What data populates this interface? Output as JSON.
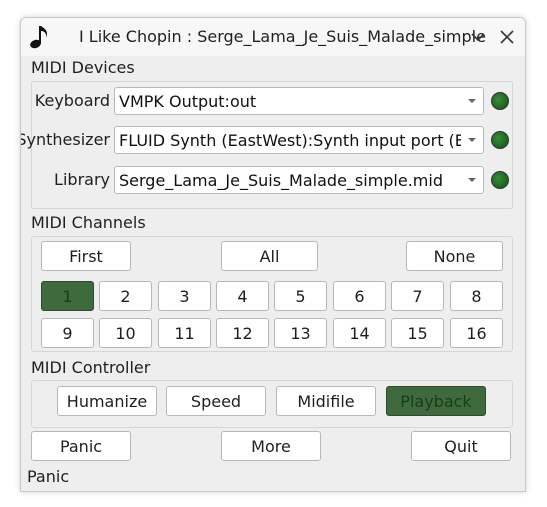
{
  "window": {
    "title": "I Like Chopin : Serge_Lama_Je_Suis_Malade_simple"
  },
  "titlebar": {
    "icons": [
      "music-note-icon",
      "chevron-down-icon",
      "close-icon"
    ]
  },
  "midi_devices": {
    "section_label": "MIDI Devices",
    "keyboard": {
      "label": "Keyboard",
      "value": "VMPK Output:out",
      "led_color": "#2a7a2a"
    },
    "synthesizer": {
      "label": "Synthesizer",
      "value": "FLUID Synth (EastWest):Synth input port (EastW",
      "led_color": "#2a7a2a"
    },
    "library": {
      "label": "Library",
      "value": "Serge_Lama_Je_Suis_Malade_simple.mid",
      "led_color": "#2a7a2a"
    }
  },
  "midi_channels": {
    "section_label": "MIDI Channels",
    "first_label": "First",
    "all_label": "All",
    "none_label": "None",
    "channels": [
      "1",
      "2",
      "3",
      "4",
      "5",
      "6",
      "7",
      "8",
      "9",
      "10",
      "11",
      "12",
      "13",
      "14",
      "15",
      "16"
    ],
    "selected": "1"
  },
  "midi_controller": {
    "section_label": "MIDI Controller",
    "humanize_label": "Humanize",
    "speed_label": "Speed",
    "midifile_label": "Midifile",
    "playback_label": "Playback",
    "active": "Playback"
  },
  "footer": {
    "panic_label": "Panic",
    "more_label": "More",
    "quit_label": "Quit"
  },
  "status_bar": {
    "text": "Panic"
  },
  "colors": {
    "active_button": "#3e6a3e",
    "led": "#2a7a2a",
    "window_bg": "#eeeeee"
  }
}
